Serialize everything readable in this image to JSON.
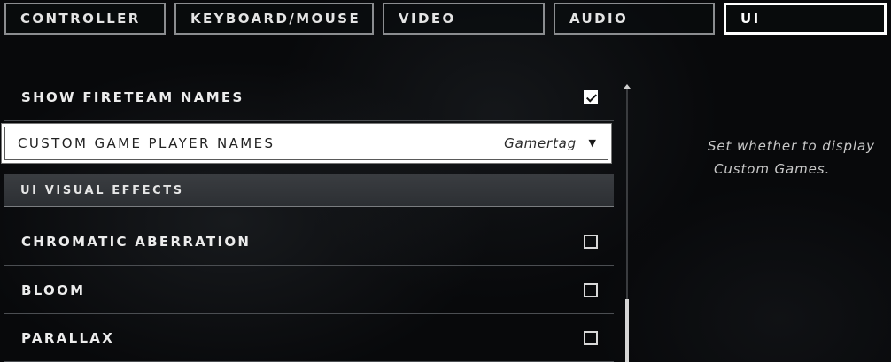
{
  "tabs": [
    {
      "label": "CONTROLLER",
      "active": false
    },
    {
      "label": "KEYBOARD/MOUSE",
      "active": false
    },
    {
      "label": "VIDEO",
      "active": false
    },
    {
      "label": "AUDIO",
      "active": false
    },
    {
      "label": "UI",
      "active": true
    }
  ],
  "settings": {
    "show_fireteam_names": {
      "label": "SHOW FIRETEAM NAMES",
      "checked": true
    },
    "custom_game_player_names": {
      "label": "CUSTOM GAME PLAYER NAMES",
      "value": "Gamertag"
    },
    "ui_visual_effects_header": "UI VISUAL EFFECTS",
    "chromatic_aberration": {
      "label": "CHROMATIC ABERRATION",
      "checked": false
    },
    "bloom": {
      "label": "BLOOM",
      "checked": false
    },
    "parallax": {
      "label": "PARALLAX",
      "checked": false
    }
  },
  "description": {
    "line1": "Set whether to display",
    "line2": "Custom Games."
  },
  "icons": {
    "dropdown_arrow": "▼",
    "checkmark": "check-icon",
    "scroll_up": "scroll-up-arrow-icon"
  },
  "colors": {
    "background": "#08090b",
    "tab_border": "#8b8d90",
    "active_tab_border": "#ffffff",
    "selected_row": "#ffffff",
    "section_header": "#34373b"
  }
}
